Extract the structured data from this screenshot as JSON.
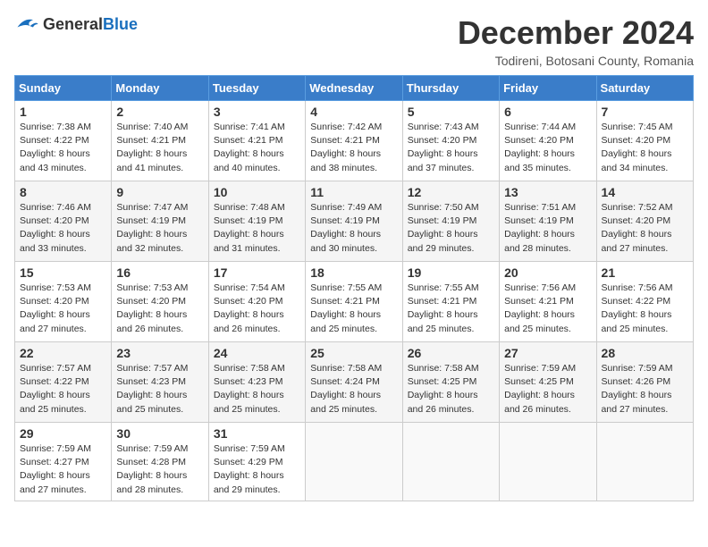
{
  "header": {
    "logo_general": "General",
    "logo_blue": "Blue",
    "month_title": "December 2024",
    "location": "Todireni, Botosani County, Romania"
  },
  "weekdays": [
    "Sunday",
    "Monday",
    "Tuesday",
    "Wednesday",
    "Thursday",
    "Friday",
    "Saturday"
  ],
  "weeks": [
    [
      {
        "day": "1",
        "sunrise": "7:38 AM",
        "sunset": "4:22 PM",
        "daylight": "8 hours and 43 minutes."
      },
      {
        "day": "2",
        "sunrise": "7:40 AM",
        "sunset": "4:21 PM",
        "daylight": "8 hours and 41 minutes."
      },
      {
        "day": "3",
        "sunrise": "7:41 AM",
        "sunset": "4:21 PM",
        "daylight": "8 hours and 40 minutes."
      },
      {
        "day": "4",
        "sunrise": "7:42 AM",
        "sunset": "4:21 PM",
        "daylight": "8 hours and 38 minutes."
      },
      {
        "day": "5",
        "sunrise": "7:43 AM",
        "sunset": "4:20 PM",
        "daylight": "8 hours and 37 minutes."
      },
      {
        "day": "6",
        "sunrise": "7:44 AM",
        "sunset": "4:20 PM",
        "daylight": "8 hours and 35 minutes."
      },
      {
        "day": "7",
        "sunrise": "7:45 AM",
        "sunset": "4:20 PM",
        "daylight": "8 hours and 34 minutes."
      }
    ],
    [
      {
        "day": "8",
        "sunrise": "7:46 AM",
        "sunset": "4:20 PM",
        "daylight": "8 hours and 33 minutes."
      },
      {
        "day": "9",
        "sunrise": "7:47 AM",
        "sunset": "4:19 PM",
        "daylight": "8 hours and 32 minutes."
      },
      {
        "day": "10",
        "sunrise": "7:48 AM",
        "sunset": "4:19 PM",
        "daylight": "8 hours and 31 minutes."
      },
      {
        "day": "11",
        "sunrise": "7:49 AM",
        "sunset": "4:19 PM",
        "daylight": "8 hours and 30 minutes."
      },
      {
        "day": "12",
        "sunrise": "7:50 AM",
        "sunset": "4:19 PM",
        "daylight": "8 hours and 29 minutes."
      },
      {
        "day": "13",
        "sunrise": "7:51 AM",
        "sunset": "4:19 PM",
        "daylight": "8 hours and 28 minutes."
      },
      {
        "day": "14",
        "sunrise": "7:52 AM",
        "sunset": "4:20 PM",
        "daylight": "8 hours and 27 minutes."
      }
    ],
    [
      {
        "day": "15",
        "sunrise": "7:53 AM",
        "sunset": "4:20 PM",
        "daylight": "8 hours and 27 minutes."
      },
      {
        "day": "16",
        "sunrise": "7:53 AM",
        "sunset": "4:20 PM",
        "daylight": "8 hours and 26 minutes."
      },
      {
        "day": "17",
        "sunrise": "7:54 AM",
        "sunset": "4:20 PM",
        "daylight": "8 hours and 26 minutes."
      },
      {
        "day": "18",
        "sunrise": "7:55 AM",
        "sunset": "4:21 PM",
        "daylight": "8 hours and 25 minutes."
      },
      {
        "day": "19",
        "sunrise": "7:55 AM",
        "sunset": "4:21 PM",
        "daylight": "8 hours and 25 minutes."
      },
      {
        "day": "20",
        "sunrise": "7:56 AM",
        "sunset": "4:21 PM",
        "daylight": "8 hours and 25 minutes."
      },
      {
        "day": "21",
        "sunrise": "7:56 AM",
        "sunset": "4:22 PM",
        "daylight": "8 hours and 25 minutes."
      }
    ],
    [
      {
        "day": "22",
        "sunrise": "7:57 AM",
        "sunset": "4:22 PM",
        "daylight": "8 hours and 25 minutes."
      },
      {
        "day": "23",
        "sunrise": "7:57 AM",
        "sunset": "4:23 PM",
        "daylight": "8 hours and 25 minutes."
      },
      {
        "day": "24",
        "sunrise": "7:58 AM",
        "sunset": "4:23 PM",
        "daylight": "8 hours and 25 minutes."
      },
      {
        "day": "25",
        "sunrise": "7:58 AM",
        "sunset": "4:24 PM",
        "daylight": "8 hours and 25 minutes."
      },
      {
        "day": "26",
        "sunrise": "7:58 AM",
        "sunset": "4:25 PM",
        "daylight": "8 hours and 26 minutes."
      },
      {
        "day": "27",
        "sunrise": "7:59 AM",
        "sunset": "4:25 PM",
        "daylight": "8 hours and 26 minutes."
      },
      {
        "day": "28",
        "sunrise": "7:59 AM",
        "sunset": "4:26 PM",
        "daylight": "8 hours and 27 minutes."
      }
    ],
    [
      {
        "day": "29",
        "sunrise": "7:59 AM",
        "sunset": "4:27 PM",
        "daylight": "8 hours and 27 minutes."
      },
      {
        "day": "30",
        "sunrise": "7:59 AM",
        "sunset": "4:28 PM",
        "daylight": "8 hours and 28 minutes."
      },
      {
        "day": "31",
        "sunrise": "7:59 AM",
        "sunset": "4:29 PM",
        "daylight": "8 hours and 29 minutes."
      },
      null,
      null,
      null,
      null
    ]
  ]
}
